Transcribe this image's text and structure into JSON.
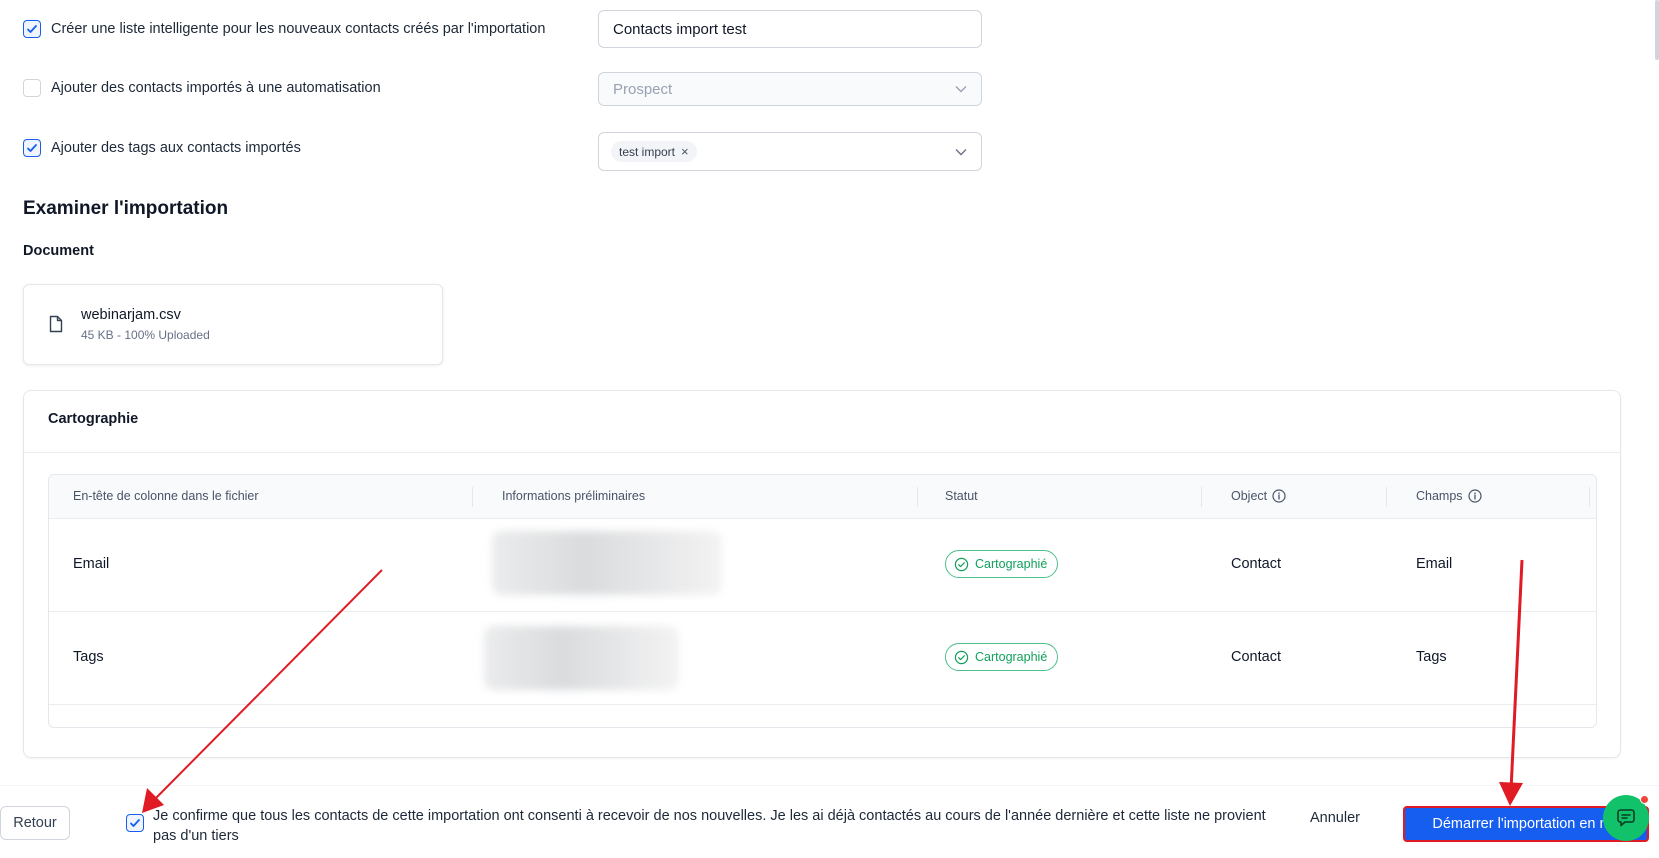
{
  "options": {
    "smart_list": {
      "label": "Créer une liste intelligente pour les nouveaux contacts créés par l'importation",
      "checked": true,
      "value": "Contacts import test"
    },
    "automation": {
      "label": "Ajouter des contacts importés à une automatisation",
      "checked": false,
      "placeholder": "Prospect"
    },
    "tags": {
      "label": "Ajouter des tags aux contacts importés",
      "checked": true,
      "tag": "test import"
    }
  },
  "review": {
    "title": "Examiner l'importation",
    "document_label": "Document",
    "file": {
      "name": "webinarjam.csv",
      "meta": "45 KB - 100% Uploaded"
    }
  },
  "mapping": {
    "title": "Cartographie",
    "columns": [
      "En-tête de colonne dans le fichier",
      "Informations préliminaires",
      "Statut",
      "Object",
      "Champs"
    ],
    "rows": [
      {
        "header": "Email",
        "status": "Cartographié",
        "object": "Contact",
        "field": "Email"
      },
      {
        "header": "Tags",
        "status": "Cartographié",
        "object": "Contact",
        "field": "Tags"
      }
    ]
  },
  "footer": {
    "back": "Retour",
    "consent": "Je confirme que tous les contacts de cette importation ont consenti à recevoir de nos nouvelles. Je les ai déjà contactés au cours de l'année dernière et cette liste ne provient pas d'un tiers",
    "consent_checked": true,
    "cancel": "Annuler",
    "start": "Démarrer l'importation en ma"
  },
  "colors": {
    "primary": "#155eef",
    "success": "#12a05c",
    "annotation": "#e01b24",
    "chat": "#12c26b"
  }
}
